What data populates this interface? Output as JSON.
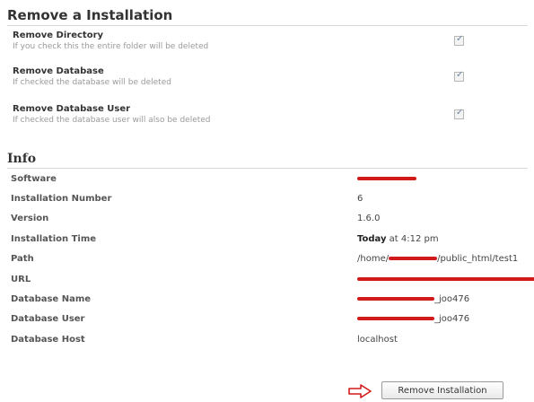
{
  "remove_section": {
    "title": "Remove a Installation",
    "options": [
      {
        "title": "Remove Directory",
        "description": "If you check this the entire folder will be deleted",
        "checked": true
      },
      {
        "title": "Remove Database",
        "description": "If checked the database will be deleted",
        "checked": true
      },
      {
        "title": "Remove Database User",
        "description": "If checked the database user will also be deleted",
        "checked": true
      }
    ]
  },
  "info": {
    "title": "Info",
    "rows": [
      {
        "label": "Software",
        "value": ""
      },
      {
        "label": "Installation Number",
        "value": "6"
      },
      {
        "label": "Version",
        "value": "1.6.0"
      },
      {
        "label": "Installation Time",
        "value_bold": "Today",
        "value": "at 4:12 pm"
      },
      {
        "label": "Path",
        "value_prefix": "/home/",
        "value_suffix": "/public_html/test1"
      },
      {
        "label": "URL",
        "value": ""
      },
      {
        "label": "Database Name",
        "value_suffix": "_joo476"
      },
      {
        "label": "Database User",
        "value_suffix": "_joo476"
      },
      {
        "label": "Database Host",
        "value": "localhost"
      }
    ]
  },
  "actions": {
    "remove_button_label": "Remove Installation"
  },
  "colors": {
    "redaction": "#d11b1b",
    "arrow": "#d11b1b"
  }
}
